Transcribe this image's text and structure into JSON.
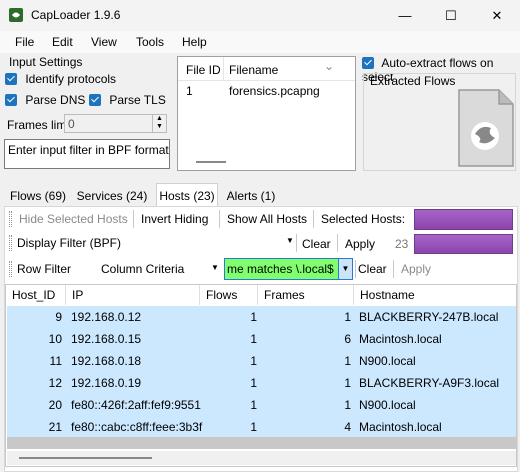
{
  "window": {
    "title": "CapLoader 1.9.6",
    "minimize": "—",
    "maximize": "☐",
    "close": "✕"
  },
  "menu": [
    "File",
    "Edit",
    "View",
    "Tools",
    "Help"
  ],
  "input_settings": {
    "label": "Input Settings",
    "identify_protocols": "Identify protocols",
    "parse_dns": "Parse DNS",
    "parse_tls": "Parse TLS",
    "frames_limit_label": "Frames limit",
    "frames_limit_value": "0",
    "bpf_placeholder": "Enter input filter in BPF format"
  },
  "files": {
    "col_file_id": "File ID",
    "col_filename": "Filename",
    "rows": [
      {
        "id": "1",
        "name": "forensics.pcapng"
      }
    ]
  },
  "auto_extract": "Auto-extract flows on select",
  "extracted_flows": "Extracted Flows",
  "tabs": [
    "Flows (69)",
    "Services (24)",
    "Hosts (23)",
    "Alerts (1)"
  ],
  "active_tab": 2,
  "toolbar1": {
    "hide_selected": "Hide Selected Hosts",
    "invert_hiding": "Invert Hiding",
    "show_all": "Show All Hosts",
    "selected_hosts": "Selected Hosts:"
  },
  "toolbar2": {
    "display_filter": "Display Filter (BPF)",
    "clear": "Clear",
    "apply": "Apply",
    "count": "23"
  },
  "toolbar3": {
    "row_filter": "Row Filter",
    "column_criteria": "Column Criteria",
    "expression": "me matches \\.local$",
    "clear": "Clear",
    "apply": "Apply"
  },
  "grid": {
    "headers": [
      "Host_ID",
      "IP",
      "Flows",
      "Frames",
      "Hostname"
    ],
    "rows": [
      {
        "id": "9",
        "ip": "192.168.0.12",
        "flows": "1",
        "frames": "1",
        "hostname": "BLACKBERRY-247B.local"
      },
      {
        "id": "10",
        "ip": "192.168.0.15",
        "flows": "1",
        "frames": "6",
        "hostname": "Macintosh.local"
      },
      {
        "id": "11",
        "ip": "192.168.0.18",
        "flows": "1",
        "frames": "1",
        "hostname": "N900.local"
      },
      {
        "id": "12",
        "ip": "192.168.0.19",
        "flows": "1",
        "frames": "1",
        "hostname": "BLACKBERRY-A9F3.local"
      },
      {
        "id": "20",
        "ip": "fe80::426f:2aff:fef9:9551",
        "flows": "1",
        "frames": "1",
        "hostname": "N900.local"
      },
      {
        "id": "21",
        "ip": "fe80::cabc:c8ff:feee:3b3f",
        "flows": "1",
        "frames": "4",
        "hostname": "Macintosh.local"
      }
    ]
  }
}
